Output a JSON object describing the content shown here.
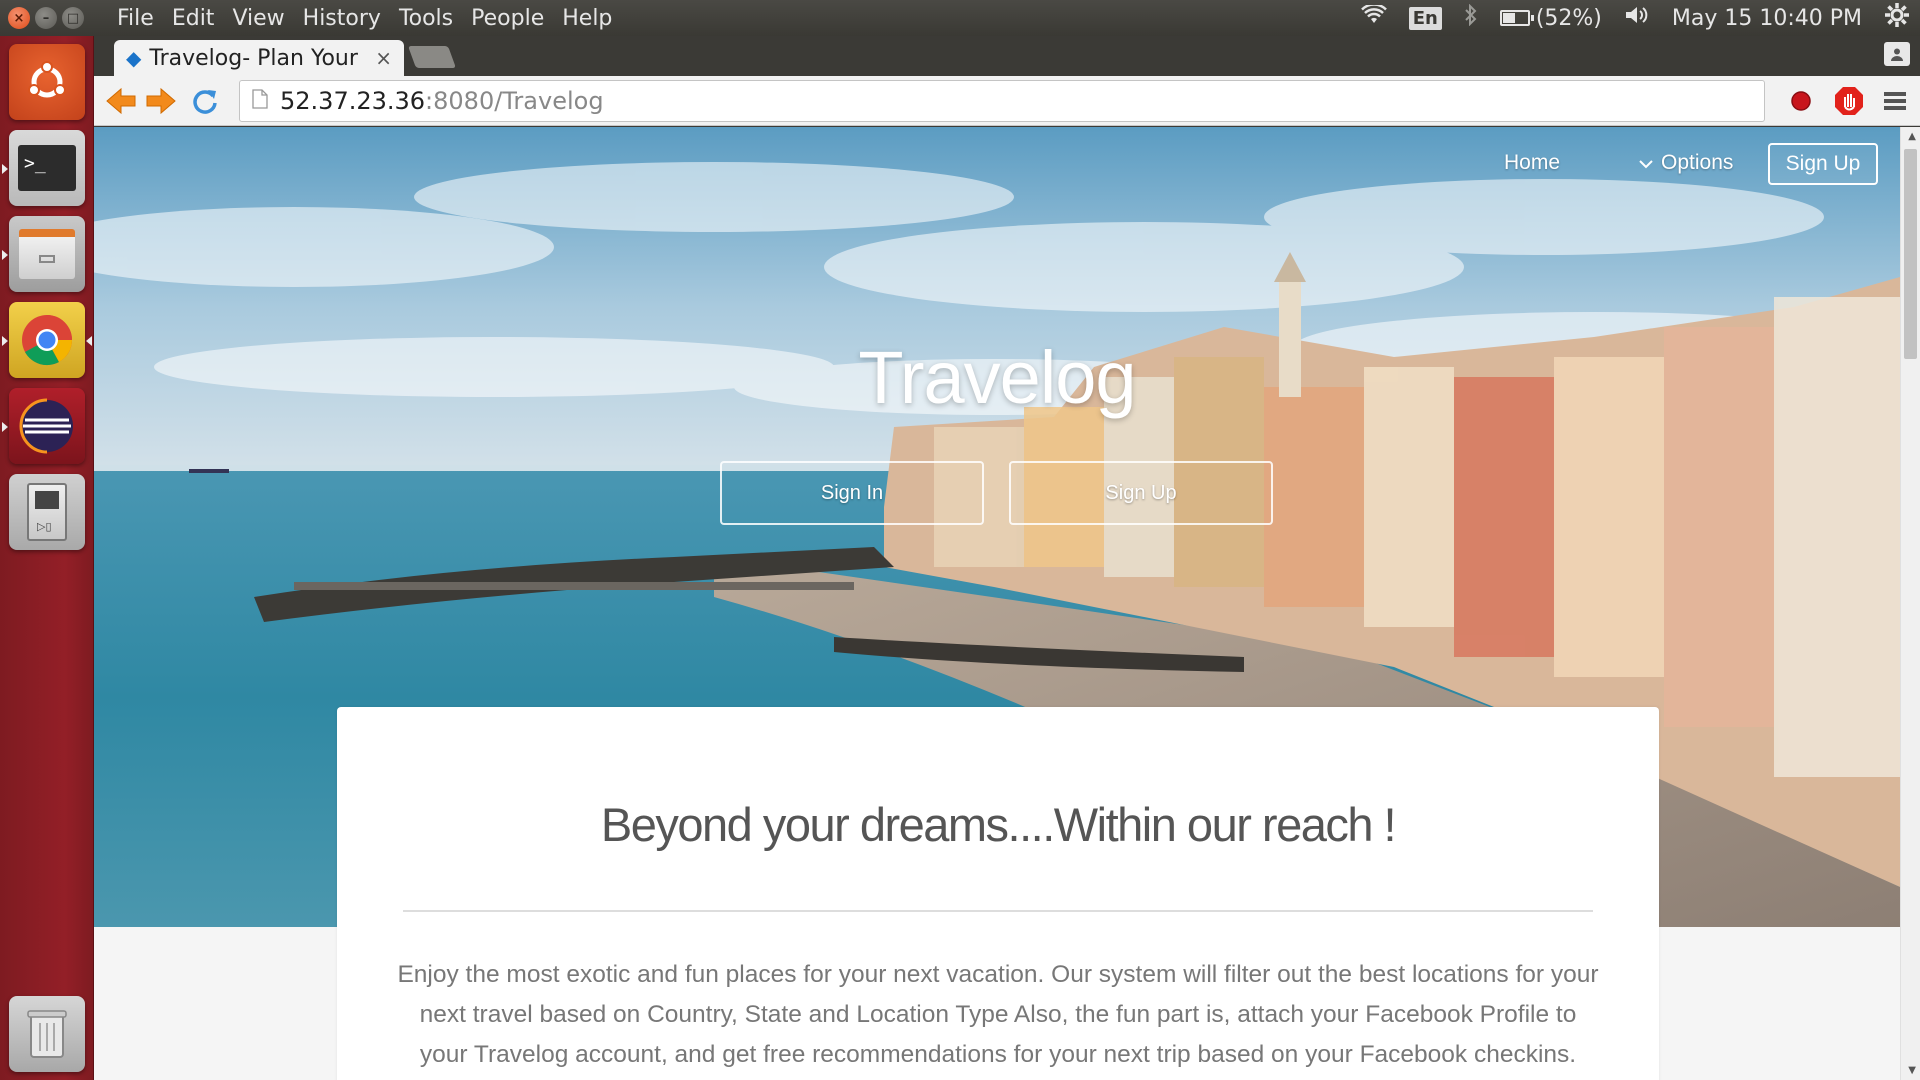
{
  "system_panel": {
    "menu": [
      "File",
      "Edit",
      "View",
      "History",
      "Tools",
      "People",
      "Help"
    ],
    "language": "En",
    "battery_text": "(52%)",
    "battery_level": 0.52,
    "datetime": "May 15 10:40 PM"
  },
  "launcher": {
    "items": [
      "ubuntu-dash-icon",
      "terminal-icon",
      "files-icon",
      "chrome-icon",
      "eclipse-icon",
      "media-player-icon",
      "trash-icon"
    ]
  },
  "browser": {
    "tab_title": "Travelog- Plan Your",
    "url_host": "52.37.23.36",
    "url_path": ":8080/Travelog"
  },
  "site": {
    "nav": {
      "home": "Home",
      "options": "Options",
      "signup": "Sign Up"
    },
    "hero": {
      "title": "Travelog",
      "signin_button": "Sign In",
      "signup_button": "Sign Up"
    },
    "intro": {
      "heading": "Beyond your dreams....Within our reach !",
      "body": "Enjoy the most exotic and fun places for your next vacation. Our system will filter out the best locations for your next travel based on Country, State and Location Type Also, the fun part is, attach your Facebook Profile to your Travelog account, and get free recommendations for your next trip based on your Facebook checkins."
    }
  },
  "colors": {
    "launcher_bg": "#931f27",
    "panel_bg": "#3c3b37",
    "close_btn": "#df4a16",
    "card_text": "#777777"
  }
}
